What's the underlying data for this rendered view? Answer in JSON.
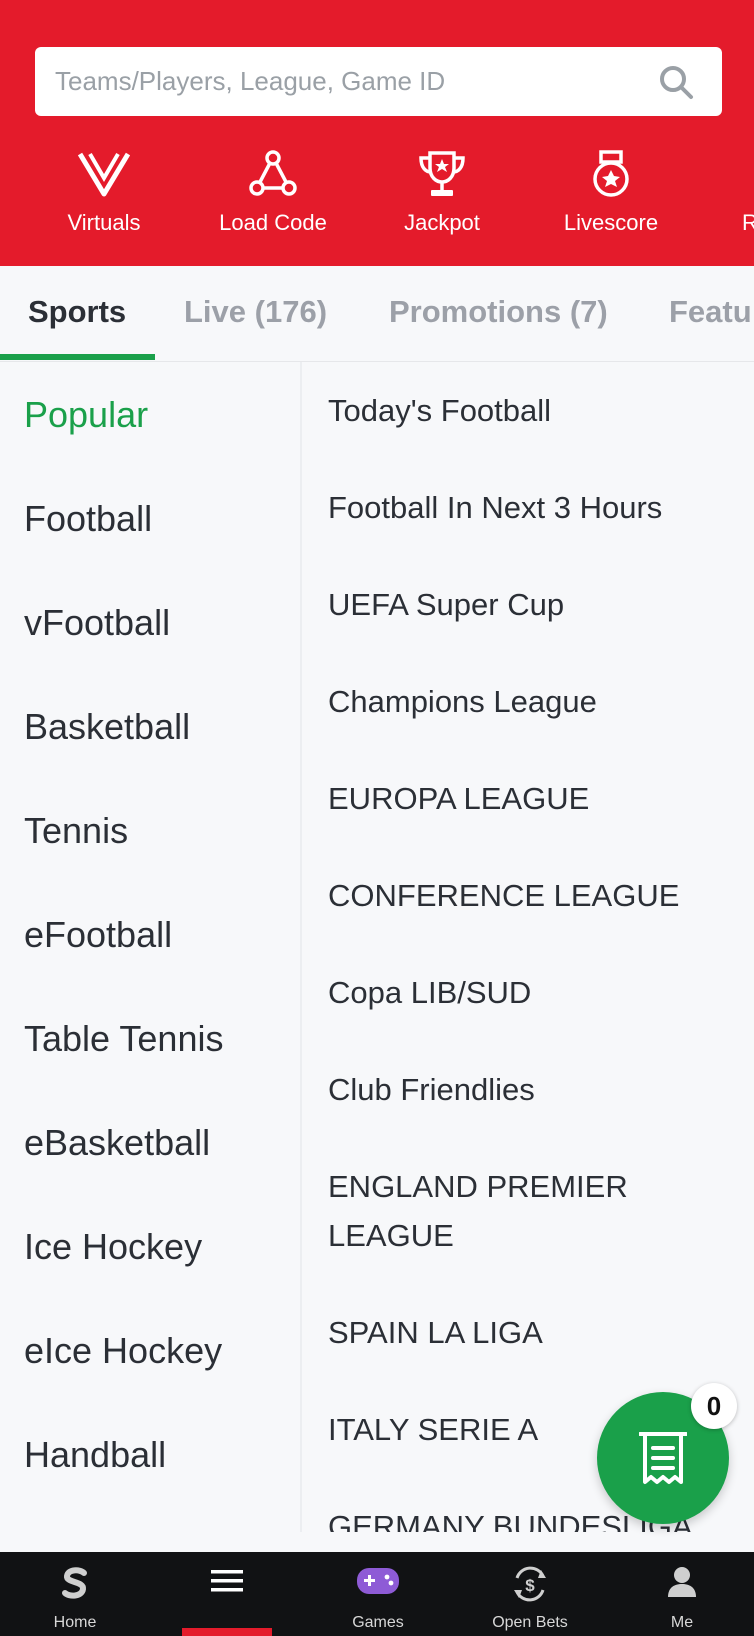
{
  "search": {
    "placeholder": "Teams/Players, League, Game ID"
  },
  "quick_links": [
    {
      "label": "Virtuals",
      "icon": "virtuals-icon"
    },
    {
      "label": "Load Code",
      "icon": "load-code-icon"
    },
    {
      "label": "Jackpot",
      "icon": "trophy-icon"
    },
    {
      "label": "Livescore",
      "icon": "medal-icon"
    },
    {
      "label": "R"
    }
  ],
  "tabs": [
    {
      "label": "Sports",
      "active": true
    },
    {
      "label": "Live (176)"
    },
    {
      "label": "Promotions (7)"
    },
    {
      "label": "Featu"
    }
  ],
  "sports": [
    "Popular",
    "Football",
    "vFootball",
    "Basketball",
    "Tennis",
    "eFootball",
    "Table Tennis",
    "eBasketball",
    "Ice Hockey",
    "eIce Hockey",
    "Handball"
  ],
  "leagues": [
    "Today's Football",
    "Football In Next 3 Hours",
    "UEFA Super Cup",
    "Champions League",
    "EUROPA LEAGUE",
    "CONFERENCE LEAGUE",
    "Copa LIB/SUD",
    "Club Friendlies",
    "ENGLAND PREMIER LEAGUE",
    "SPAIN LA LIGA",
    "ITALY SERIE A",
    "GERMANY BUNDESLIGA"
  ],
  "betslip": {
    "count": "0"
  },
  "bottom_nav": [
    {
      "label": "Home",
      "icon": "sportybet-s-icon"
    },
    {
      "label": "",
      "icon": "menu-icon",
      "active": true
    },
    {
      "label": "Games",
      "icon": "gamepad-icon"
    },
    {
      "label": "Open Bets",
      "icon": "open-bets-icon"
    },
    {
      "label": "Me",
      "icon": "user-icon"
    }
  ],
  "colors": {
    "brand_red": "#e41b2b",
    "accent_green": "#1aa04a"
  }
}
